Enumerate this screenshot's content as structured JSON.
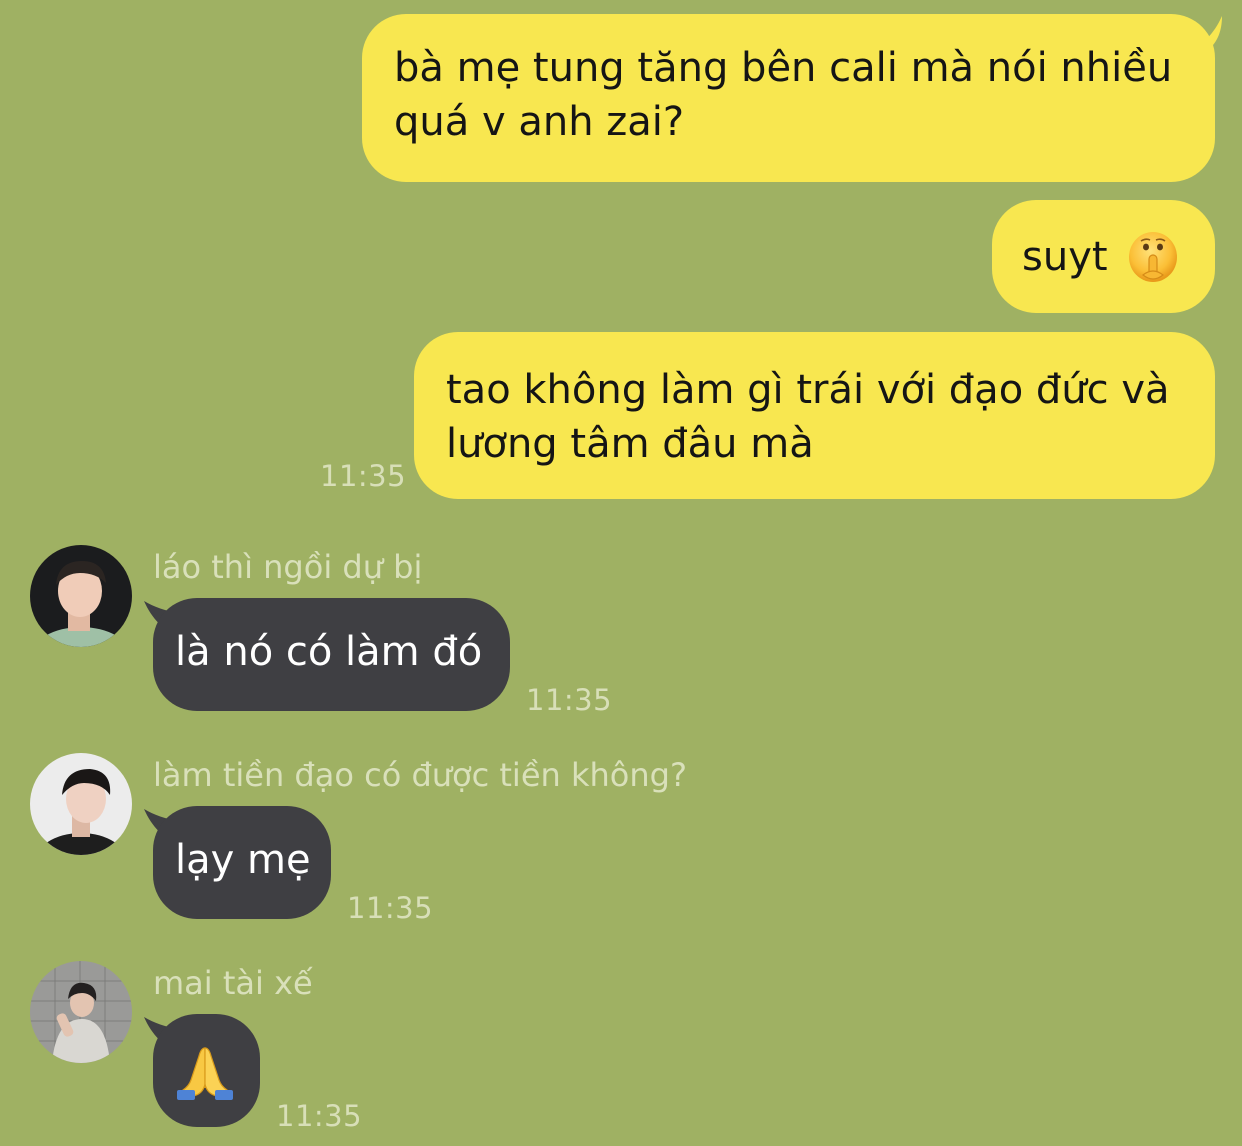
{
  "colors": {
    "background": "#9fb163",
    "sent_bubble": "#f8e750",
    "received_bubble": "#3f3f43",
    "timestamp": "#d8dfb8",
    "sender_name": "#d9e0ba"
  },
  "messages": {
    "sent_1": {
      "text": "bà mẹ tung tăng bên cali mà nói nhiều quá v anh zai?"
    },
    "sent_2": {
      "text": "suyt",
      "emoji": "shushing-face-emoji"
    },
    "sent_3": {
      "text": "tao không làm gì trái với đạo đức và lương tâm đâu mà",
      "time": "11:35"
    },
    "recv_1": {
      "sender": "láo thì ngồi dự bị",
      "text": "là nó có làm đó",
      "time": "11:35",
      "avatar": "avatar-photo"
    },
    "recv_2": {
      "sender": "làm tiền đạo có được tiền không?",
      "text": "lạy mẹ",
      "time": "11:35",
      "avatar": "avatar-photo"
    },
    "recv_3": {
      "sender": "mai tài xế",
      "emoji": "folded-hands-emoji",
      "time": "11:35",
      "avatar": "avatar-photo"
    }
  }
}
